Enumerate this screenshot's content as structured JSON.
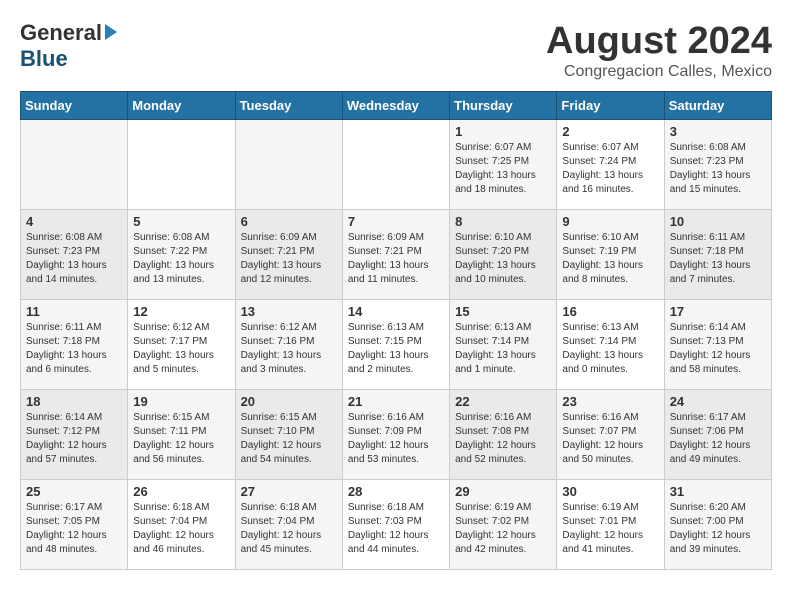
{
  "logo": {
    "general": "General",
    "blue": "Blue"
  },
  "title": "August 2024",
  "location": "Congregacion Calles, Mexico",
  "days_of_week": [
    "Sunday",
    "Monday",
    "Tuesday",
    "Wednesday",
    "Thursday",
    "Friday",
    "Saturday"
  ],
  "weeks": [
    [
      {
        "day": "",
        "content": ""
      },
      {
        "day": "",
        "content": ""
      },
      {
        "day": "",
        "content": ""
      },
      {
        "day": "",
        "content": ""
      },
      {
        "day": "1",
        "content": "Sunrise: 6:07 AM\nSunset: 7:25 PM\nDaylight: 13 hours\nand 18 minutes."
      },
      {
        "day": "2",
        "content": "Sunrise: 6:07 AM\nSunset: 7:24 PM\nDaylight: 13 hours\nand 16 minutes."
      },
      {
        "day": "3",
        "content": "Sunrise: 6:08 AM\nSunset: 7:23 PM\nDaylight: 13 hours\nand 15 minutes."
      }
    ],
    [
      {
        "day": "4",
        "content": "Sunrise: 6:08 AM\nSunset: 7:23 PM\nDaylight: 13 hours\nand 14 minutes."
      },
      {
        "day": "5",
        "content": "Sunrise: 6:08 AM\nSunset: 7:22 PM\nDaylight: 13 hours\nand 13 minutes."
      },
      {
        "day": "6",
        "content": "Sunrise: 6:09 AM\nSunset: 7:21 PM\nDaylight: 13 hours\nand 12 minutes."
      },
      {
        "day": "7",
        "content": "Sunrise: 6:09 AM\nSunset: 7:21 PM\nDaylight: 13 hours\nand 11 minutes."
      },
      {
        "day": "8",
        "content": "Sunrise: 6:10 AM\nSunset: 7:20 PM\nDaylight: 13 hours\nand 10 minutes."
      },
      {
        "day": "9",
        "content": "Sunrise: 6:10 AM\nSunset: 7:19 PM\nDaylight: 13 hours\nand 8 minutes."
      },
      {
        "day": "10",
        "content": "Sunrise: 6:11 AM\nSunset: 7:18 PM\nDaylight: 13 hours\nand 7 minutes."
      }
    ],
    [
      {
        "day": "11",
        "content": "Sunrise: 6:11 AM\nSunset: 7:18 PM\nDaylight: 13 hours\nand 6 minutes."
      },
      {
        "day": "12",
        "content": "Sunrise: 6:12 AM\nSunset: 7:17 PM\nDaylight: 13 hours\nand 5 minutes."
      },
      {
        "day": "13",
        "content": "Sunrise: 6:12 AM\nSunset: 7:16 PM\nDaylight: 13 hours\nand 3 minutes."
      },
      {
        "day": "14",
        "content": "Sunrise: 6:13 AM\nSunset: 7:15 PM\nDaylight: 13 hours\nand 2 minutes."
      },
      {
        "day": "15",
        "content": "Sunrise: 6:13 AM\nSunset: 7:14 PM\nDaylight: 13 hours\nand 1 minute."
      },
      {
        "day": "16",
        "content": "Sunrise: 6:13 AM\nSunset: 7:14 PM\nDaylight: 13 hours\nand 0 minutes."
      },
      {
        "day": "17",
        "content": "Sunrise: 6:14 AM\nSunset: 7:13 PM\nDaylight: 12 hours\nand 58 minutes."
      }
    ],
    [
      {
        "day": "18",
        "content": "Sunrise: 6:14 AM\nSunset: 7:12 PM\nDaylight: 12 hours\nand 57 minutes."
      },
      {
        "day": "19",
        "content": "Sunrise: 6:15 AM\nSunset: 7:11 PM\nDaylight: 12 hours\nand 56 minutes."
      },
      {
        "day": "20",
        "content": "Sunrise: 6:15 AM\nSunset: 7:10 PM\nDaylight: 12 hours\nand 54 minutes."
      },
      {
        "day": "21",
        "content": "Sunrise: 6:16 AM\nSunset: 7:09 PM\nDaylight: 12 hours\nand 53 minutes."
      },
      {
        "day": "22",
        "content": "Sunrise: 6:16 AM\nSunset: 7:08 PM\nDaylight: 12 hours\nand 52 minutes."
      },
      {
        "day": "23",
        "content": "Sunrise: 6:16 AM\nSunset: 7:07 PM\nDaylight: 12 hours\nand 50 minutes."
      },
      {
        "day": "24",
        "content": "Sunrise: 6:17 AM\nSunset: 7:06 PM\nDaylight: 12 hours\nand 49 minutes."
      }
    ],
    [
      {
        "day": "25",
        "content": "Sunrise: 6:17 AM\nSunset: 7:05 PM\nDaylight: 12 hours\nand 48 minutes."
      },
      {
        "day": "26",
        "content": "Sunrise: 6:18 AM\nSunset: 7:04 PM\nDaylight: 12 hours\nand 46 minutes."
      },
      {
        "day": "27",
        "content": "Sunrise: 6:18 AM\nSunset: 7:04 PM\nDaylight: 12 hours\nand 45 minutes."
      },
      {
        "day": "28",
        "content": "Sunrise: 6:18 AM\nSunset: 7:03 PM\nDaylight: 12 hours\nand 44 minutes."
      },
      {
        "day": "29",
        "content": "Sunrise: 6:19 AM\nSunset: 7:02 PM\nDaylight: 12 hours\nand 42 minutes."
      },
      {
        "day": "30",
        "content": "Sunrise: 6:19 AM\nSunset: 7:01 PM\nDaylight: 12 hours\nand 41 minutes."
      },
      {
        "day": "31",
        "content": "Sunrise: 6:20 AM\nSunset: 7:00 PM\nDaylight: 12 hours\nand 39 minutes."
      }
    ]
  ]
}
